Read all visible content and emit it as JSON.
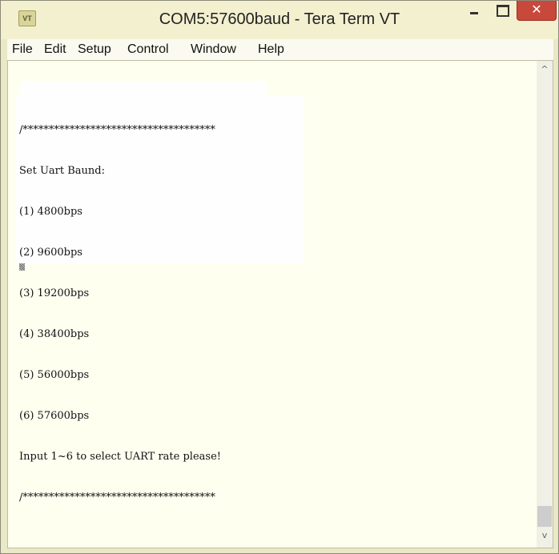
{
  "window": {
    "title": "COM5:57600baud - Tera Term VT",
    "icon": "tera-term-app-icon"
  },
  "controls": {
    "minimize_icon": "minimize-icon",
    "maximize_icon": "maximize-icon",
    "close_label": "✕"
  },
  "menu": {
    "items": [
      "File",
      "Edit",
      "Setup",
      "Control",
      "Window",
      "Help"
    ]
  },
  "terminal": {
    "lines": [
      "/*************************************",
      "Set Uart Baund:",
      "(1) 4800bps",
      "(2) 9600bps",
      "(3) 19200bps",
      "(4) 38400bps",
      "(5) 56000bps",
      "(6) 57600bps",
      "Input 1~6 to select UART rate please!",
      "/*************************************"
    ]
  },
  "scrollbar": {
    "up_arrow": "^",
    "down_arrow": "v"
  },
  "colors": {
    "frame": "#eae8c5",
    "terminal_bg": "#fffff0",
    "close_button": "#c9483c"
  }
}
